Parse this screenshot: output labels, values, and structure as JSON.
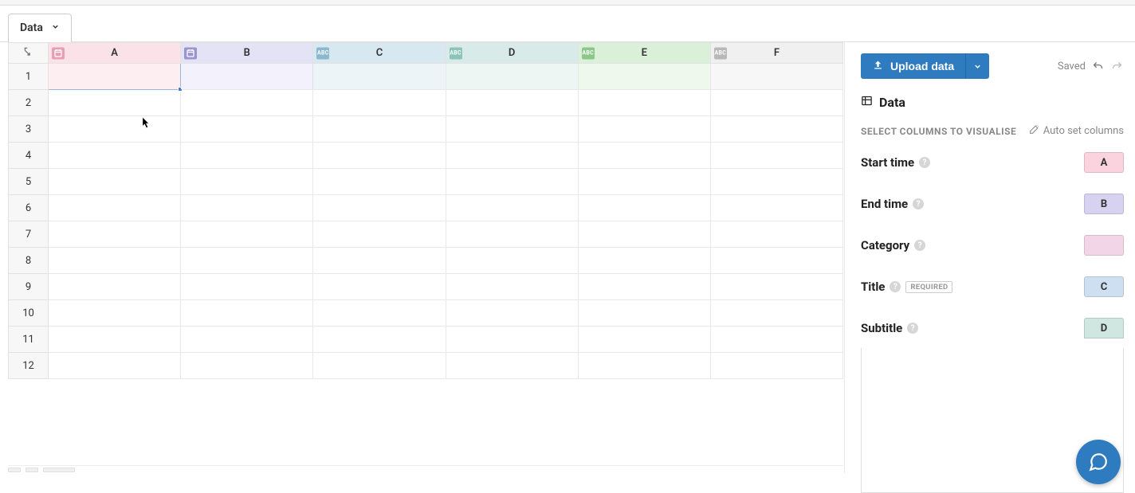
{
  "tab": {
    "label": "Data"
  },
  "columns": [
    {
      "letter": "A",
      "type": "date",
      "colorClass": "pink"
    },
    {
      "letter": "B",
      "type": "date",
      "colorClass": "purple"
    },
    {
      "letter": "C",
      "type": "text",
      "colorClass": "blue"
    },
    {
      "letter": "D",
      "type": "text",
      "colorClass": "teal"
    },
    {
      "letter": "E",
      "type": "text",
      "colorClass": "green"
    },
    {
      "letter": "F",
      "type": "text",
      "colorClass": "gray"
    }
  ],
  "rowCount": 12,
  "panel": {
    "upload_label": "Upload data",
    "saved_label": "Saved",
    "section_title": "Data",
    "select_caps": "SELECT COLUMNS TO VISUALISE",
    "auto_set_label": "Auto set columns",
    "required_badge": "REQUIRED",
    "mappings": [
      {
        "label": "Start time",
        "pill": "A",
        "pillClass": "pillA",
        "required": false
      },
      {
        "label": "End time",
        "pill": "B",
        "pillClass": "pillB",
        "required": false
      },
      {
        "label": "Category",
        "pill": "",
        "pillClass": "pillCat",
        "required": false
      },
      {
        "label": "Title",
        "pill": "C",
        "pillClass": "pillC",
        "required": true
      },
      {
        "label": "Subtitle",
        "pill": "D",
        "pillClass": "pillD",
        "required": false
      }
    ]
  }
}
